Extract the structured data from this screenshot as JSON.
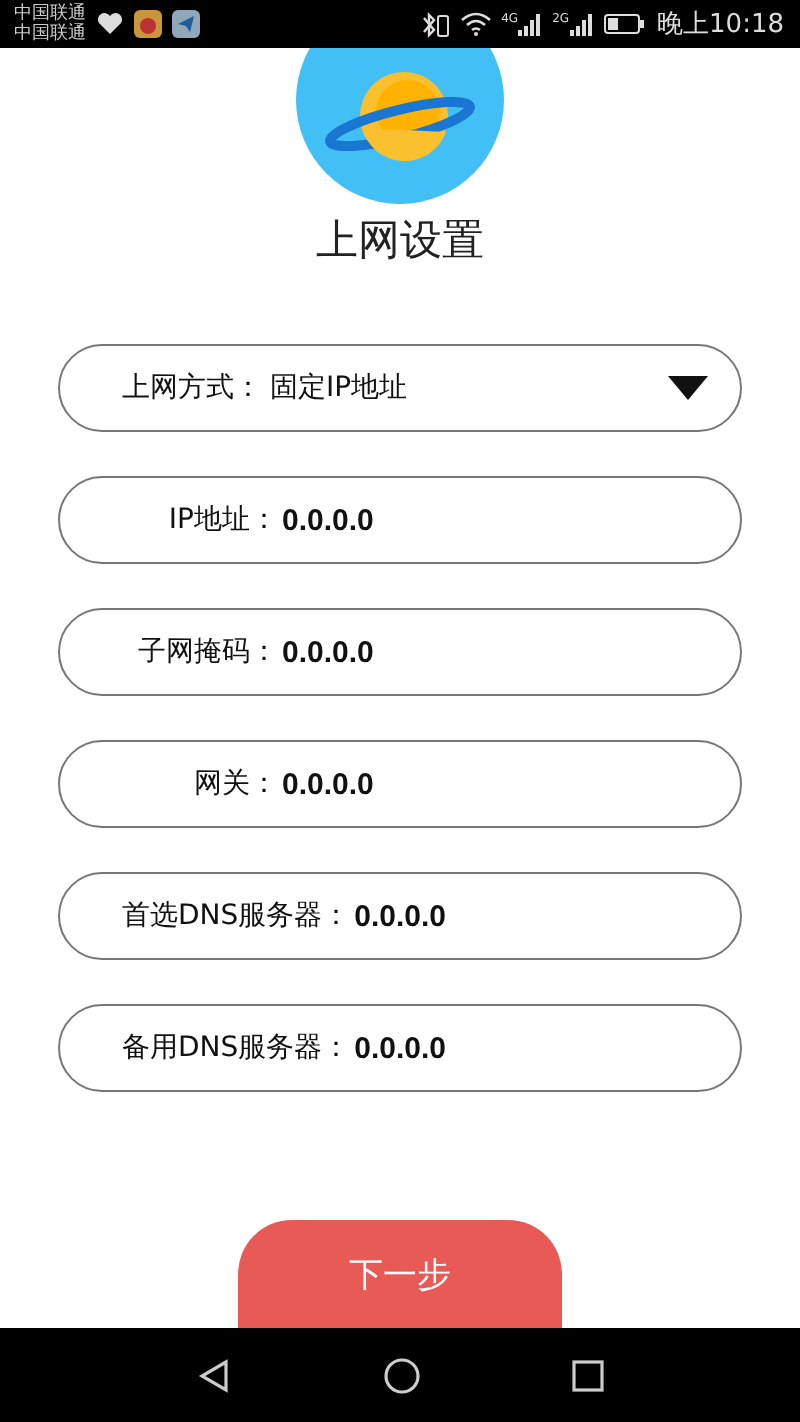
{
  "status_bar": {
    "carriers": [
      "中国联通",
      "中国联通"
    ],
    "network_labels": [
      "4G",
      "2G"
    ],
    "time": "晚上10:18"
  },
  "title": "上网设置",
  "fields": [
    {
      "kind": "select",
      "label": "上网方式：",
      "value": "固定IP地址"
    },
    {
      "kind": "text",
      "label": "IP地址：",
      "value": "0.0.0.0"
    },
    {
      "kind": "text",
      "label": "子网掩码：",
      "value": "0.0.0.0"
    },
    {
      "kind": "text",
      "label": "网关：",
      "value": "0.0.0.0"
    },
    {
      "kind": "text",
      "label": "首选DNS服务器：",
      "value": "0.0.0.0"
    },
    {
      "kind": "text",
      "label": "备用DNS服务器：",
      "value": "0.0.0.0"
    }
  ],
  "next_button": "下一步"
}
